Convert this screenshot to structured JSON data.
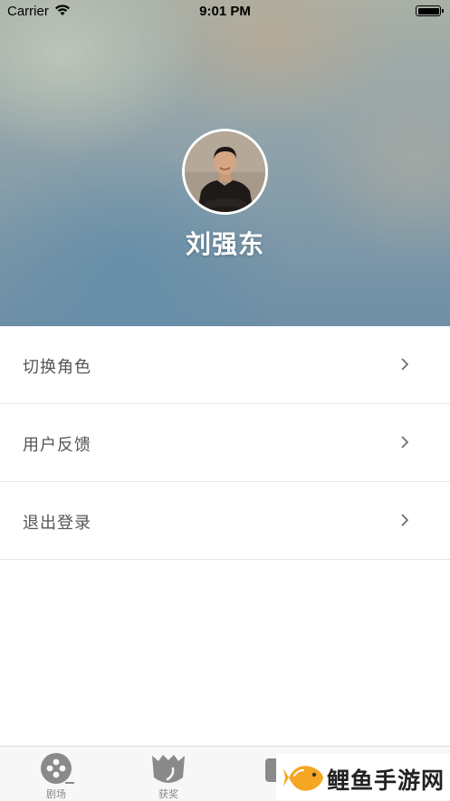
{
  "status_bar": {
    "carrier": "Carrier",
    "time": "9:01 PM"
  },
  "profile": {
    "name": "刘强东"
  },
  "menu": {
    "items": [
      {
        "label": "切换角色"
      },
      {
        "label": "用户反馈"
      },
      {
        "label": "退出登录"
      }
    ]
  },
  "tabbar": {
    "tabs": [
      {
        "label": "剧场",
        "icon": "film-reel-icon"
      },
      {
        "label": "获奖",
        "icon": "trophy-icon"
      },
      {
        "label": "",
        "icon": "message-icon"
      },
      {
        "label": "",
        "icon": "profile-icon"
      }
    ]
  },
  "watermark": {
    "text": "鲤鱼手游网"
  },
  "colors": {
    "menu_text": "#555555",
    "divider": "#e6e6e6",
    "tab_icon": "#8a8a8a",
    "accent_green": "#2bb38f",
    "fish_orange": "#f5a623"
  }
}
